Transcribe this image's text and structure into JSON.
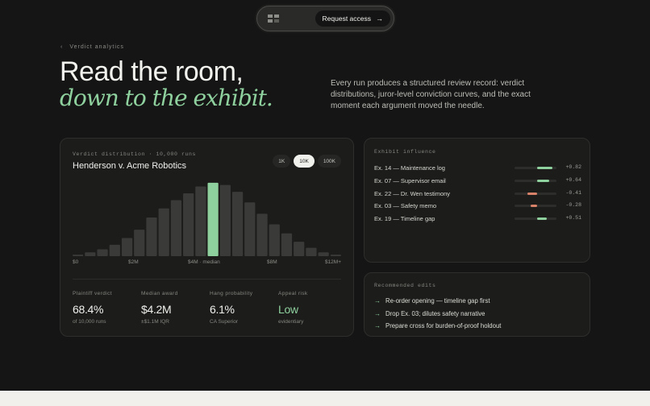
{
  "nav": {
    "cta_label": "Request access",
    "cta_icon": "arrow-right-icon",
    "logo_icon": "logo-mark-icon"
  },
  "hero": {
    "eyebrow": "Verdict analytics",
    "title_line1": "Read the room,",
    "title_line2": "down to the exhibit.",
    "lede": "Every run produces a structured review record: verdict distributions, juror-level conviction curves, and the exact moment each argument moved the needle."
  },
  "distribution": {
    "label": "Verdict distribution · 10,000 runs",
    "case_title": "Henderson v. Acme Robotics",
    "run_options": [
      "1K",
      "10K",
      "100K"
    ],
    "selected_run": "10K",
    "axis_labels": [
      "$0",
      "$2M",
      "$4M · median",
      "$8M",
      "$12M+"
    ],
    "stats": [
      {
        "label": "Plaintiff verdict",
        "value": "68.4%",
        "sub": "of 10,000 runs"
      },
      {
        "label": "Median award",
        "value": "$4.2M",
        "sub": "±$1.1M IQR"
      },
      {
        "label": "Hang probability",
        "value": "6.1%",
        "sub": "CA Superior"
      },
      {
        "label": "Appeal risk",
        "value": "Low",
        "sub": "evidentiary"
      }
    ]
  },
  "chart_data": {
    "type": "bar",
    "values": [
      2,
      5,
      9,
      15,
      24,
      35,
      51,
      63,
      74,
      83,
      92,
      97,
      94,
      85,
      71,
      56,
      42,
      30,
      19,
      11,
      5,
      2
    ],
    "highlight_index": 11,
    "ylim": [
      0,
      100
    ],
    "grid": false
  },
  "exhibits": {
    "label": "Exhibit influence",
    "items": [
      {
        "name": "Ex. 14 — Maintenance log",
        "value": "+0.82",
        "score": 0.82
      },
      {
        "name": "Ex. 07 — Supervisor email",
        "value": "+0.64",
        "score": 0.64
      },
      {
        "name": "Ex. 22 — Dr. Wen testimony",
        "value": "-0.41",
        "score": -0.41
      },
      {
        "name": "Ex. 03 — Safety memo",
        "value": "-0.28",
        "score": -0.28
      },
      {
        "name": "Ex. 19 — Timeline gap",
        "value": "+0.51",
        "score": 0.51
      }
    ]
  },
  "recommended": {
    "label": "Recommended edits",
    "items": [
      "Re-order opening — timeline gap first",
      "Drop Ex. 03; dilutes safety narrative",
      "Prepare cross for burden-of-proof holdout"
    ]
  },
  "colors": {
    "accent": "#8fd19e",
    "negative": "#d9826a",
    "bar": "#3a3a39"
  }
}
